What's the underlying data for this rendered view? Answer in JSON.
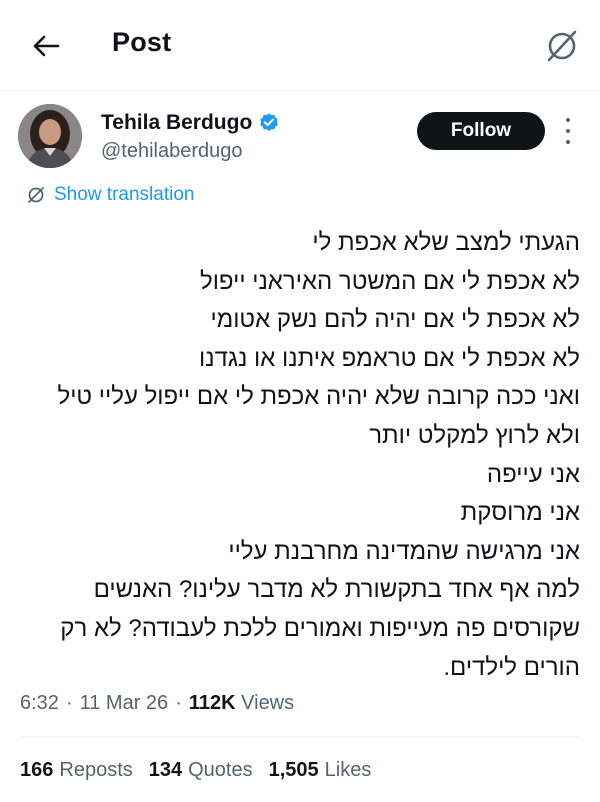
{
  "header": {
    "title": "Post",
    "back_icon": "arrow-left-icon",
    "translate_icon": "translate-slash-icon"
  },
  "author": {
    "name": "Tehila Berdugo",
    "handle": "@tehilaberdugo",
    "verified": true,
    "follow_label": "Follow"
  },
  "translation": {
    "label": "Show translation"
  },
  "post": {
    "lines": [
      "הגעתי למצב שלא אכפת לי",
      "לא אכפת לי אם המשטר האיראני ייפול",
      "לא אכפת לי אם יהיה להם נשק אטומי",
      "לא אכפת לי אם טראמפ איתנו או נגדנו",
      "ואני ככה קרובה שלא יהיה אכפת לי אם ייפול עליי טיל",
      "ולא לרוץ למקלט יותר",
      "אני עייפה",
      "אני מרוסקת",
      "אני מרגישה שהמדינה מחרבנת עליי",
      "למה אף אחד בתקשורת לא מדבר עלינו? האנשים",
      "שקורסים פה מעייפות ואמורים ללכת לעבודה? לא רק",
      "הורים לילדים."
    ]
  },
  "meta": {
    "time": "6:32",
    "date": "11 Mar 26",
    "views_count": "112K",
    "views_label": "Views"
  },
  "stats": {
    "reposts_count": "166",
    "reposts_label": "Reposts",
    "quotes_count": "134",
    "quotes_label": "Quotes",
    "likes_count": "1,505",
    "likes_label": "Likes"
  },
  "colors": {
    "accent": "#1d9bf0",
    "text": "#0f1419",
    "secondary": "#536471",
    "follow_bg": "#0f1419"
  }
}
